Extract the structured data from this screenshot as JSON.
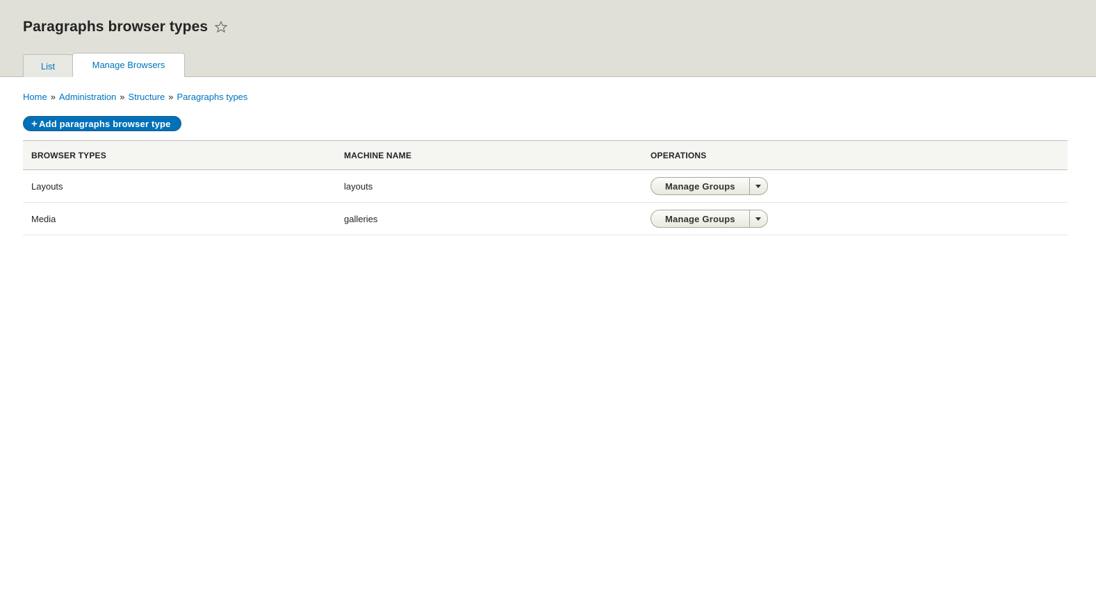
{
  "header": {
    "title": "Paragraphs browser types",
    "tabs": [
      {
        "label": "List",
        "active": false
      },
      {
        "label": "Manage Browsers",
        "active": true
      }
    ]
  },
  "breadcrumb": {
    "items": [
      "Home",
      "Administration",
      "Structure",
      "Paragraphs types"
    ],
    "separator": "»"
  },
  "actions": {
    "add_label": "Add paragraphs browser type",
    "add_icon": "+"
  },
  "table": {
    "columns": [
      "Browser types",
      "Machine name",
      "Operations"
    ],
    "rows": [
      {
        "name": "Layouts",
        "machine": "layouts",
        "operation": "Manage Groups"
      },
      {
        "name": "Media",
        "machine": "galleries",
        "operation": "Manage Groups"
      }
    ]
  },
  "colors": {
    "link": "#0074bd",
    "primary_button": "#0071b8",
    "header_bg": "#e0e0d8"
  }
}
